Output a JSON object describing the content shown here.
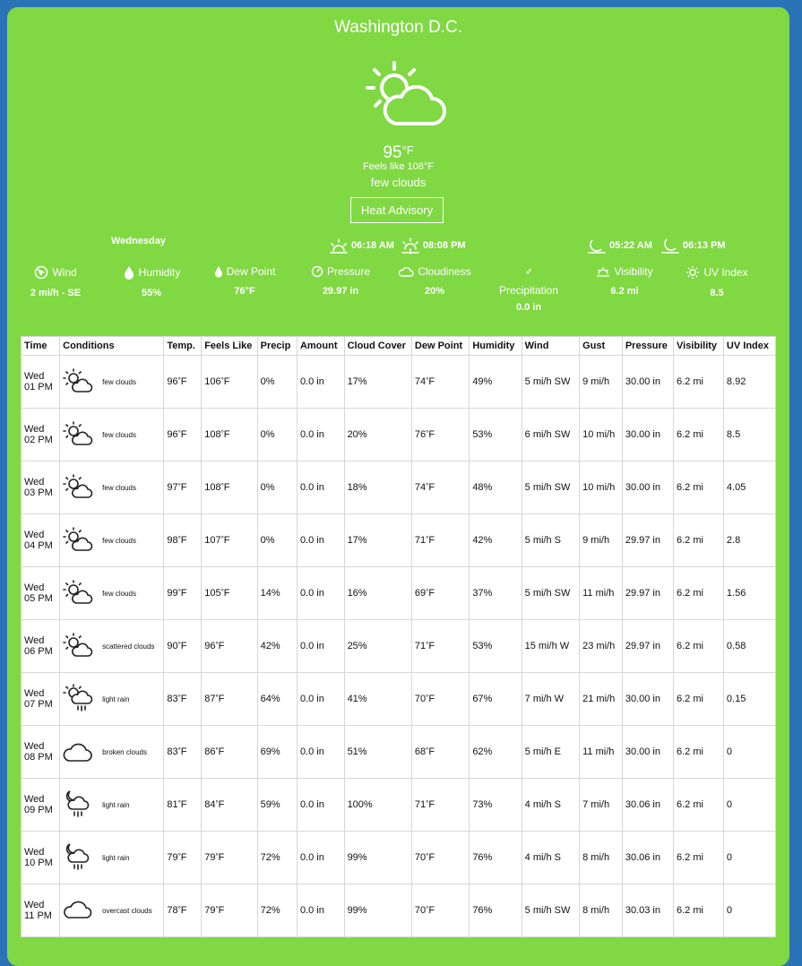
{
  "city": "Washington D.C.",
  "current": {
    "temp": "95",
    "unit": "°F",
    "feels_like": "Feels like 108°F",
    "description": "few clouds",
    "icon": "partly-cloudy-day-icon"
  },
  "advisory_label": "Heat Advisory",
  "day_name": "Wednesday",
  "sun": {
    "sunrise": "06:18 AM",
    "sunset": "08:08 PM"
  },
  "moon": {
    "moonrise": "05:22 AM",
    "moonset": "06:13 PM"
  },
  "stats": {
    "wind": {
      "label": "Wind",
      "value": "2 mi/h - SE"
    },
    "humidity": {
      "label": "Humidity",
      "value": "55%"
    },
    "dew_point": {
      "label": "Dew Point",
      "value": "76°F"
    },
    "pressure": {
      "label": "Pressure",
      "value": "29.97 in"
    },
    "cloudiness": {
      "label": "Cloudiness",
      "value": "20%"
    },
    "precipitation": {
      "label": "Precipitation",
      "value": "0.0 in"
    },
    "visibility": {
      "label": "Visibility",
      "value": "6.2 mi"
    },
    "uv": {
      "label": "UV Index",
      "value": "8.5"
    }
  },
  "table": {
    "headers": [
      "Time",
      "Conditions",
      "Temp.",
      "Feels Like",
      "Precip",
      "Amount",
      "Cloud Cover",
      "Dew Point",
      "Humidity",
      "Wind",
      "Gust",
      "Pressure",
      "Visibility",
      "UV Index"
    ],
    "rows": [
      {
        "day": "Wed",
        "hour": "01 PM",
        "icon": "sun-cloud",
        "cond": "few clouds",
        "temp": "96°F",
        "feels": "106°F",
        "precip": "0%",
        "amount": "0.0 in",
        "cloud": "17%",
        "dew": "74°F",
        "humidity": "49%",
        "wind": "5 mi/h SW",
        "gust": "9 mi/h",
        "pressure": "30.00 in",
        "visibility": "6.2 mi",
        "uv": "8.92"
      },
      {
        "day": "Wed",
        "hour": "02 PM",
        "icon": "sun-cloud",
        "cond": "few clouds",
        "temp": "96°F",
        "feels": "108°F",
        "precip": "0%",
        "amount": "0.0 in",
        "cloud": "20%",
        "dew": "76°F",
        "humidity": "53%",
        "wind": "6 mi/h SW",
        "gust": "10 mi/h",
        "pressure": "30.00 in",
        "visibility": "6.2 mi",
        "uv": "8.5"
      },
      {
        "day": "Wed",
        "hour": "03 PM",
        "icon": "sun-cloud",
        "cond": "few clouds",
        "temp": "97°F",
        "feels": "108°F",
        "precip": "0%",
        "amount": "0.0 in",
        "cloud": "18%",
        "dew": "74°F",
        "humidity": "48%",
        "wind": "5 mi/h SW",
        "gust": "10 mi/h",
        "pressure": "30.00 in",
        "visibility": "6.2 mi",
        "uv": "4.05"
      },
      {
        "day": "Wed",
        "hour": "04 PM",
        "icon": "sun-cloud",
        "cond": "few clouds",
        "temp": "98°F",
        "feels": "107°F",
        "precip": "0%",
        "amount": "0.0 in",
        "cloud": "17%",
        "dew": "71°F",
        "humidity": "42%",
        "wind": "5 mi/h S",
        "gust": "9 mi/h",
        "pressure": "29.97 in",
        "visibility": "6.2 mi",
        "uv": "2.8"
      },
      {
        "day": "Wed",
        "hour": "05 PM",
        "icon": "sun-cloud",
        "cond": "few clouds",
        "temp": "99°F",
        "feels": "105°F",
        "precip": "14%",
        "amount": "0.0 in",
        "cloud": "16%",
        "dew": "69°F",
        "humidity": "37%",
        "wind": "5 mi/h SW",
        "gust": "11 mi/h",
        "pressure": "29.97 in",
        "visibility": "6.2 mi",
        "uv": "1.56"
      },
      {
        "day": "Wed",
        "hour": "06 PM",
        "icon": "sun-cloud",
        "cond": "scattered clouds",
        "temp": "90°F",
        "feels": "96°F",
        "precip": "42%",
        "amount": "0.0 in",
        "cloud": "25%",
        "dew": "71°F",
        "humidity": "53%",
        "wind": "15 mi/h W",
        "gust": "23 mi/h",
        "pressure": "29.97 in",
        "visibility": "6.2 mi",
        "uv": "0.58"
      },
      {
        "day": "Wed",
        "hour": "07 PM",
        "icon": "sun-rain",
        "cond": "light rain",
        "temp": "83°F",
        "feels": "87°F",
        "precip": "64%",
        "amount": "0.0 in",
        "cloud": "41%",
        "dew": "70°F",
        "humidity": "67%",
        "wind": "7 mi/h W",
        "gust": "21 mi/h",
        "pressure": "30.00 in",
        "visibility": "6.2 mi",
        "uv": "0.15"
      },
      {
        "day": "Wed",
        "hour": "08 PM",
        "icon": "cloud",
        "cond": "broken clouds",
        "temp": "83°F",
        "feels": "86°F",
        "precip": "69%",
        "amount": "0.0 in",
        "cloud": "51%",
        "dew": "68°F",
        "humidity": "62%",
        "wind": "5 mi/h E",
        "gust": "11 mi/h",
        "pressure": "30.00 in",
        "visibility": "6.2 mi",
        "uv": "0"
      },
      {
        "day": "Wed",
        "hour": "09 PM",
        "icon": "moon-rain",
        "cond": "light rain",
        "temp": "81°F",
        "feels": "84°F",
        "precip": "59%",
        "amount": "0.0 in",
        "cloud": "100%",
        "dew": "71°F",
        "humidity": "73%",
        "wind": "4 mi/h S",
        "gust": "7 mi/h",
        "pressure": "30.06 in",
        "visibility": "6.2 mi",
        "uv": "0"
      },
      {
        "day": "Wed",
        "hour": "10 PM",
        "icon": "moon-rain",
        "cond": "light rain",
        "temp": "79°F",
        "feels": "79°F",
        "precip": "72%",
        "amount": "0.0 in",
        "cloud": "99%",
        "dew": "70°F",
        "humidity": "76%",
        "wind": "4 mi/h S",
        "gust": "8 mi/h",
        "pressure": "30.06 in",
        "visibility": "6.2 mi",
        "uv": "0"
      },
      {
        "day": "Wed",
        "hour": "11 PM",
        "icon": "cloud-flat",
        "cond": "overcast clouds",
        "temp": "78°F",
        "feels": "79°F",
        "precip": "72%",
        "amount": "0.0 in",
        "cloud": "99%",
        "dew": "70°F",
        "humidity": "76%",
        "wind": "5 mi/h SW",
        "gust": "8 mi/h",
        "pressure": "30.03 in",
        "visibility": "6.2 mi",
        "uv": "0"
      }
    ]
  }
}
